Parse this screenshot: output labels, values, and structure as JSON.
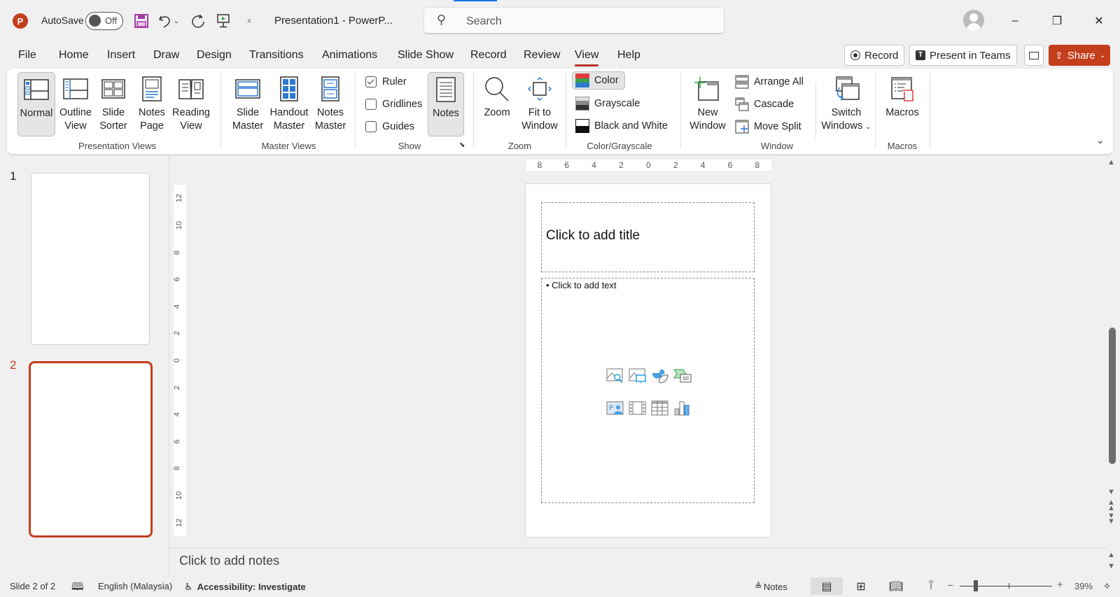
{
  "titlebar": {
    "app_icon": "powerpoint-logo-icon",
    "app_letter": "P",
    "autosave_label": "AutoSave",
    "autosave_state": "Off",
    "quick_access": [
      "save-icon",
      "undo-icon",
      "undo-dropdown-icon",
      "redo-icon",
      "start-slideshow-icon",
      "customize-qat-icon"
    ],
    "document_title": "Presentation1  -  PowerP...",
    "search_placeholder": "Search",
    "window_controls": {
      "minimize": "–",
      "restore": "❐",
      "close": "✕"
    }
  },
  "menu": {
    "tabs": [
      "File",
      "Home",
      "Insert",
      "Draw",
      "Design",
      "Transitions",
      "Animations",
      "Slide Show",
      "Record",
      "Review",
      "View",
      "Help"
    ],
    "active_tab": "View",
    "right_buttons": {
      "record": "Record",
      "present_in_teams": "Present in Teams",
      "share": "Share"
    }
  },
  "ribbon": {
    "groups": {
      "presentation_views": {
        "label": "Presentation Views",
        "buttons": [
          {
            "line1": "Normal",
            "line2": "",
            "selected": true
          },
          {
            "line1": "Outline",
            "line2": "View",
            "selected": false
          },
          {
            "line1": "Slide",
            "line2": "Sorter",
            "selected": false
          },
          {
            "line1": "Notes",
            "line2": "Page",
            "selected": false
          },
          {
            "line1": "Reading",
            "line2": "View",
            "selected": false
          }
        ]
      },
      "master_views": {
        "label": "Master Views",
        "buttons": [
          {
            "line1": "Slide",
            "line2": "Master"
          },
          {
            "line1": "Handout",
            "line2": "Master"
          },
          {
            "line1": "Notes",
            "line2": "Master"
          }
        ]
      },
      "show": {
        "label": "Show",
        "checkboxes": [
          {
            "label": "Ruler",
            "checked": true
          },
          {
            "label": "Gridlines",
            "checked": false
          },
          {
            "label": "Guides",
            "checked": false
          }
        ],
        "notes_button": "Notes",
        "notes_selected": true
      },
      "zoom": {
        "label": "Zoom",
        "zoom_button": "Zoom",
        "fit_line1": "Fit to",
        "fit_line2": "Window"
      },
      "color_grayscale": {
        "label": "Color/Grayscale",
        "options": [
          {
            "label": "Color",
            "selected": true
          },
          {
            "label": "Grayscale",
            "selected": false
          },
          {
            "label": "Black and White",
            "selected": false
          }
        ]
      },
      "window": {
        "label": "Window",
        "new_window_line1": "New",
        "new_window_line2": "Window",
        "arrange_all": "Arrange All",
        "cascade": "Cascade",
        "move_split": "Move Split",
        "switch_line1": "Switch",
        "switch_line2": "Windows"
      },
      "macros": {
        "label": "Macros",
        "button": "Macros"
      }
    }
  },
  "slides_pane": {
    "slides": [
      {
        "number": "1",
        "active": false
      },
      {
        "number": "2",
        "active": true
      }
    ]
  },
  "rulers": {
    "horizontal": [
      "8",
      "6",
      "4",
      "2",
      "0",
      "2",
      "4",
      "6",
      "8"
    ],
    "vertical": [
      "12",
      "10",
      "8",
      "6",
      "4",
      "2",
      "0",
      "2",
      "4",
      "6",
      "8",
      "10",
      "12"
    ]
  },
  "slide": {
    "title_placeholder": "Click to add title",
    "body_placeholder": "• Click to add text",
    "insert_icons": [
      "insert-stock-images-icon",
      "insert-pictures-icon",
      "insert-icons-icon",
      "insert-smartart-icon",
      "insert-cameo-icon",
      "insert-video-icon",
      "insert-table-icon",
      "insert-chart-icon"
    ]
  },
  "notes": {
    "placeholder": "Click to add notes"
  },
  "statusbar": {
    "slide_position": "Slide 2 of 2",
    "language": "English (Malaysia)",
    "accessibility": "Accessibility: Investigate",
    "notes_label": "Notes",
    "zoom_percent": "39%",
    "zoom_value": 39
  },
  "colors": {
    "accent": "#c43e1c",
    "active_tab_underline": "#b7312c",
    "ribbon_bg": "#ffffff",
    "window_bg": "#f0f0f0"
  }
}
